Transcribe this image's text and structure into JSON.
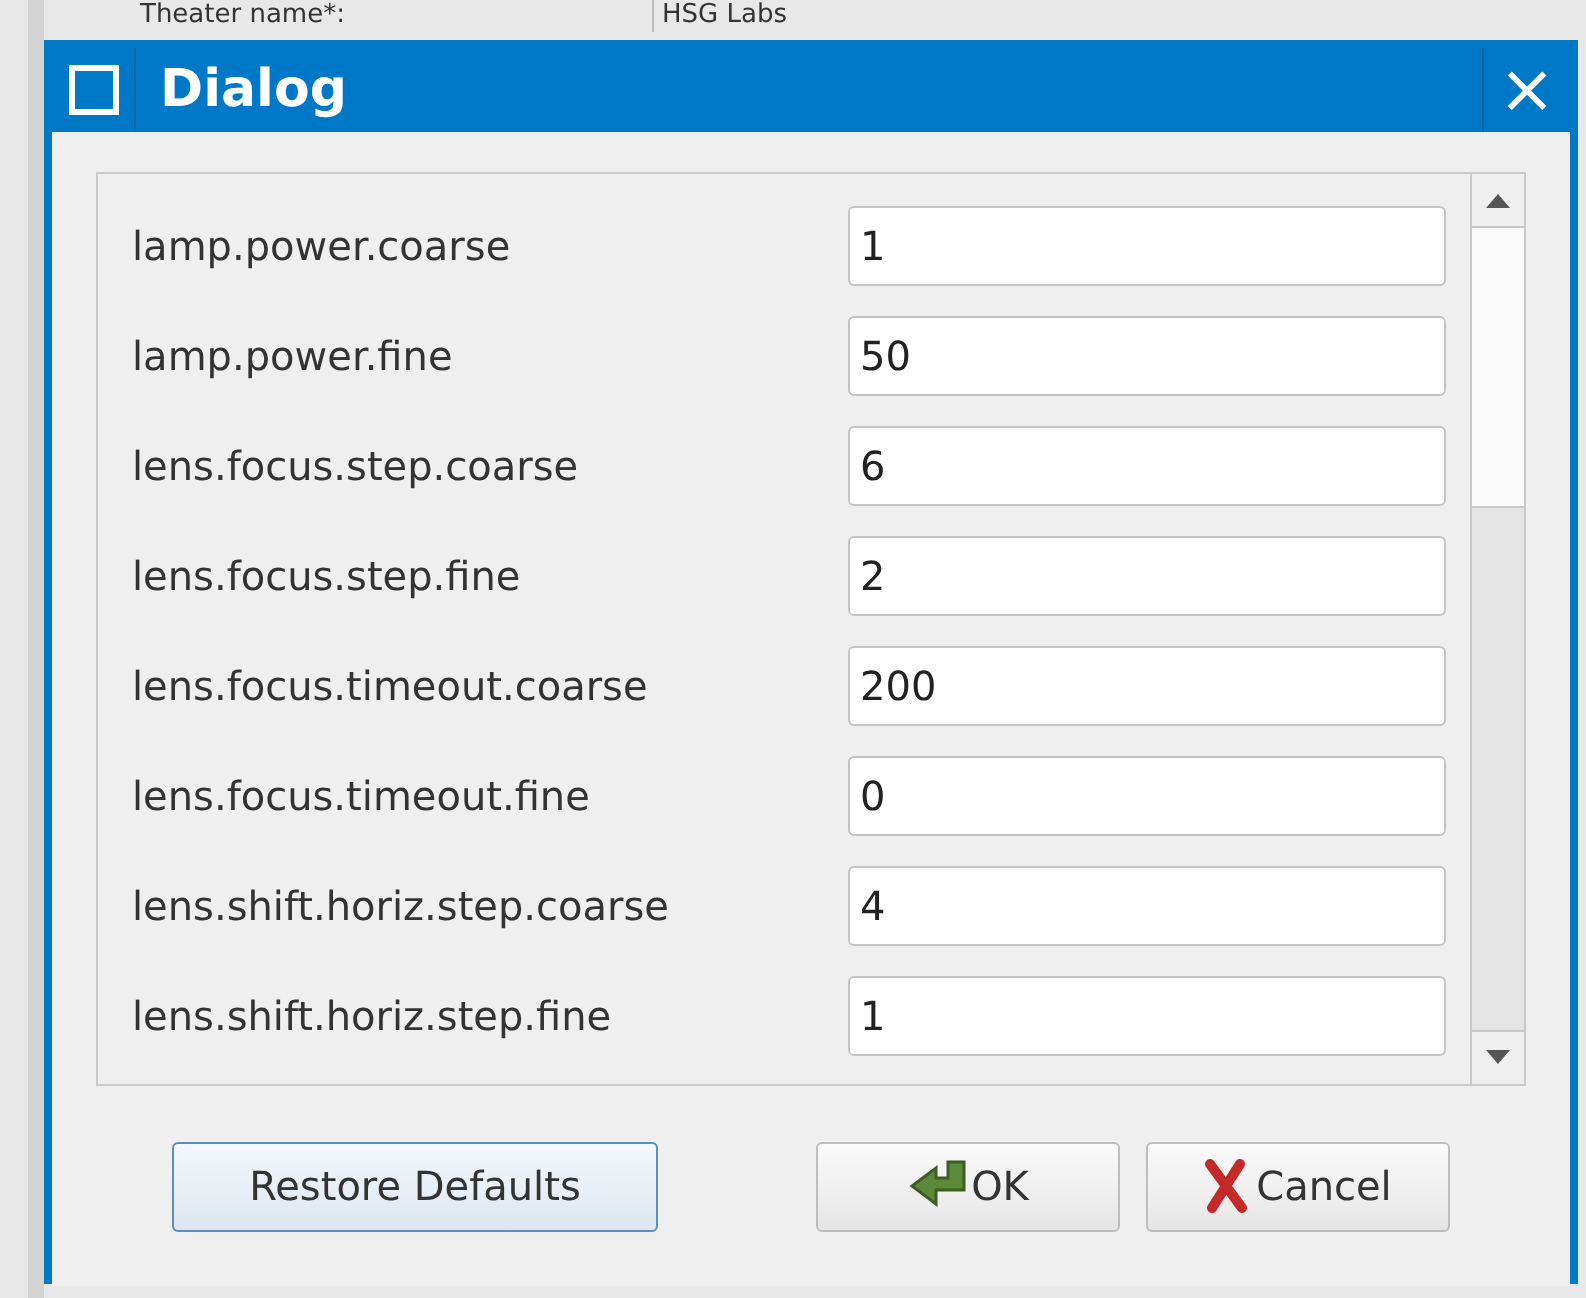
{
  "background": {
    "label": "Theater name*:",
    "value": "HSG Labs"
  },
  "window": {
    "title": "Dialog",
    "close": "×"
  },
  "settings": [
    {
      "name": "lamp.power.coarse",
      "value": "1"
    },
    {
      "name": "lamp.power.fine",
      "value": "50"
    },
    {
      "name": "lens.focus.step.coarse",
      "value": "6"
    },
    {
      "name": "lens.focus.step.fine",
      "value": "2"
    },
    {
      "name": "lens.focus.timeout.coarse",
      "value": "200"
    },
    {
      "name": "lens.focus.timeout.fine",
      "value": "0"
    },
    {
      "name": "lens.shift.horiz.step.coarse",
      "value": "4"
    },
    {
      "name": "lens.shift.horiz.step.fine",
      "value": "1"
    }
  ],
  "buttons": [
    {
      "kind": "restore",
      "label": "Restore Defaults"
    },
    {
      "kind": "ok",
      "label": "OK"
    },
    {
      "kind": "cancel",
      "label": "Cancel"
    }
  ]
}
